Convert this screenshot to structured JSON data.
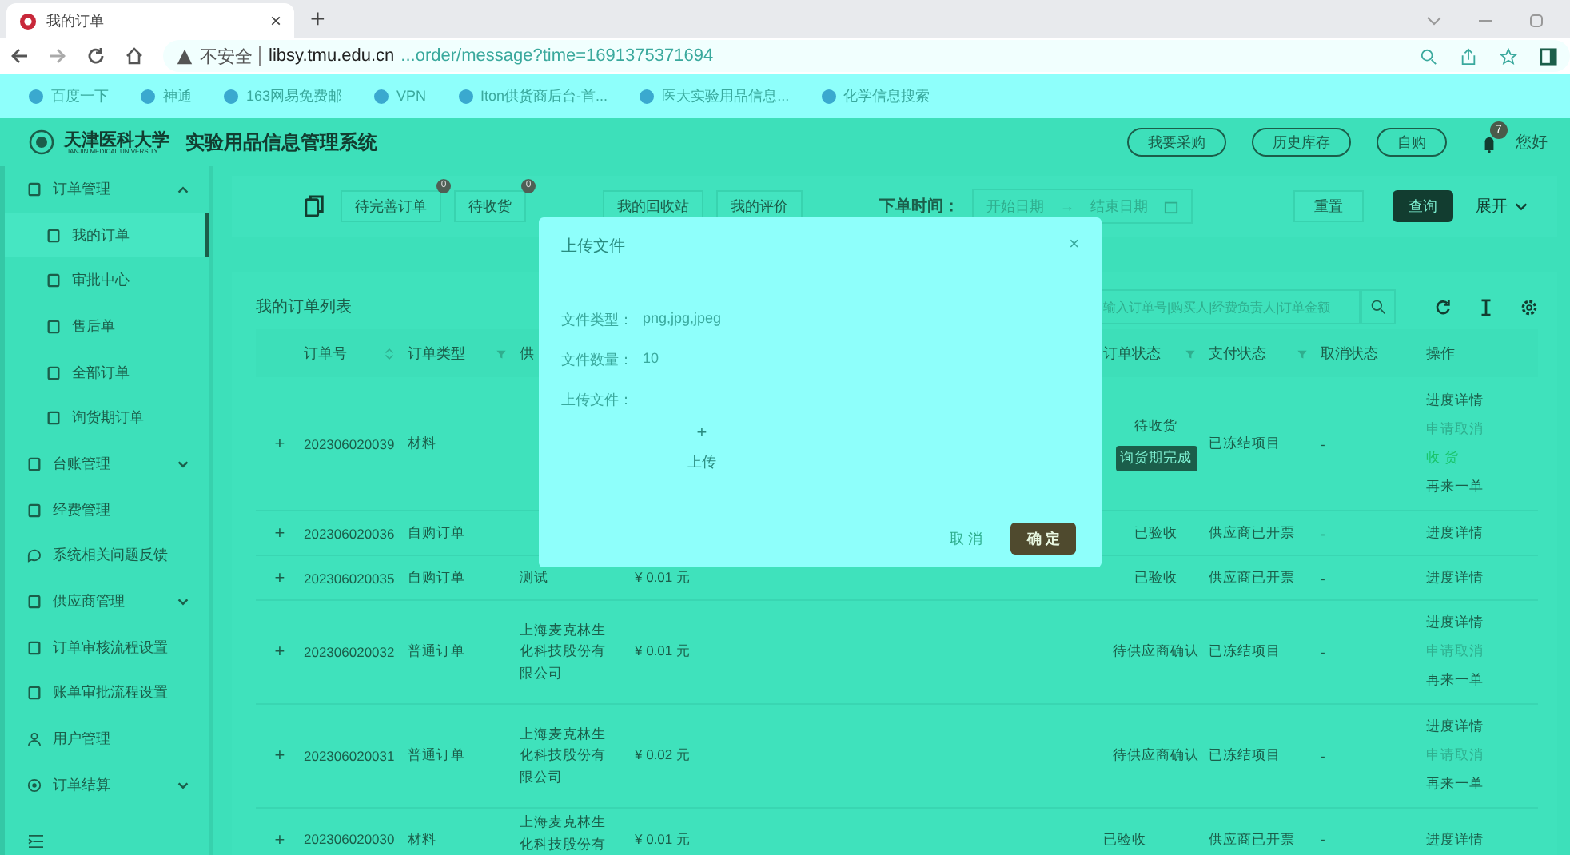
{
  "browser": {
    "tab": {
      "title": "我的订单",
      "close": "×"
    },
    "new_tab": "+",
    "address": {
      "security": "不安全",
      "host": "libsy.tmu.edu.cn",
      "path": "...order/message?time=1691375371694"
    },
    "bookmarks": [
      {
        "label": "百度一下"
      },
      {
        "label": "神通"
      },
      {
        "label": "163网易免费邮"
      },
      {
        "label": "VPN"
      },
      {
        "label": "Iton供货商后台-首..."
      },
      {
        "label": "医大实验用品信息..."
      },
      {
        "label": "化学信息搜索"
      }
    ]
  },
  "header": {
    "logo_text": "天津医科大学",
    "logo_subtitle": "TIANJIN MEDICAL UNIVERSITY",
    "title": "实验用品信息管理系统",
    "buttons": [
      "我要采购",
      "历史库存",
      "自购"
    ],
    "notification_count": "7",
    "greeting": "您好"
  },
  "sidebar": {
    "items": [
      {
        "label": "订单管理",
        "expanded": true,
        "children": [
          {
            "label": "我的订单",
            "selected": true
          },
          {
            "label": "审批中心",
            "selected": false
          },
          {
            "label": "售后单",
            "selected": false
          },
          {
            "label": "全部订单",
            "selected": false
          },
          {
            "label": "询货期订单",
            "selected": false
          }
        ]
      },
      {
        "label": "台账管理",
        "expanded": false
      },
      {
        "label": "经费管理"
      },
      {
        "label": "系统相关问题反馈"
      },
      {
        "label": "供应商管理",
        "expanded": false
      },
      {
        "label": "订单审核流程设置"
      },
      {
        "label": "账单审批流程设置"
      },
      {
        "label": "用户管理"
      },
      {
        "label": "订单结算",
        "expanded": false
      }
    ]
  },
  "filters": {
    "quick": [
      {
        "label": "待完善订单",
        "badge": "0"
      },
      {
        "label": "待收货",
        "badge": "0"
      },
      {
        "label": "我的回收站"
      },
      {
        "label": "我的评价"
      }
    ],
    "date_label": "下单时间：",
    "start_placeholder": "开始日期",
    "arrow": "→",
    "end_placeholder": "结束日期",
    "reset": "重置",
    "search": "查询",
    "expand": "展开"
  },
  "table": {
    "title": "我的订单列表",
    "search_placeholder": "输入订单号|购买人|经费负责人|订单金额",
    "columns": [
      {
        "label": "订单号",
        "sortable": true
      },
      {
        "label": "订单类型",
        "filterable": true
      },
      {
        "label": "供"
      },
      {
        "label": "订单状态",
        "filterable": true
      },
      {
        "label": "支付状态",
        "filterable": true
      },
      {
        "label": "取消状态"
      },
      {
        "label": "操作"
      }
    ],
    "rows": [
      {
        "expand": "+",
        "order_no": "202306020039",
        "type": "材料",
        "status": "待收货",
        "status_tag": "询货期完成",
        "payment": "已冻结项目",
        "cancel": "-",
        "actions": [
          {
            "label": "进度详情",
            "kind": "link"
          },
          {
            "label": "申请取消",
            "kind": "muted"
          },
          {
            "label": "收 货",
            "kind": "success"
          },
          {
            "label": "再来一单",
            "kind": "link"
          }
        ]
      },
      {
        "expand": "+",
        "order_no": "202306020036",
        "type": "自购订单",
        "status": "已验收",
        "payment": "供应商已开票",
        "cancel": "-",
        "actions": [
          {
            "label": "进度详情",
            "kind": "link"
          }
        ]
      },
      {
        "expand": "+",
        "order_no": "202306020035",
        "type": "自购订单",
        "supplier": "测试",
        "amount": "¥ 0.01 元",
        "status": "已验收",
        "payment": "供应商已开票",
        "cancel": "-",
        "actions": [
          {
            "label": "进度详情",
            "kind": "link"
          }
        ]
      },
      {
        "expand": "+",
        "order_no": "202306020032",
        "type": "普通订单",
        "supplier": "上海麦克林生化科技股份有限公司",
        "amount": "¥ 0.01 元",
        "status": "待供应商确认",
        "payment": "已冻结项目",
        "cancel": "-",
        "actions": [
          {
            "label": "进度详情",
            "kind": "link"
          },
          {
            "label": "申请取消",
            "kind": "muted"
          },
          {
            "label": "再来一单",
            "kind": "link"
          }
        ]
      },
      {
        "expand": "+",
        "order_no": "202306020031",
        "type": "普通订单",
        "supplier": "上海麦克林生化科技股份有限公司",
        "amount": "¥ 0.02 元",
        "status": "待供应商确认",
        "payment": "已冻结项目",
        "cancel": "-",
        "actions": [
          {
            "label": "进度详情",
            "kind": "link"
          },
          {
            "label": "申请取消",
            "kind": "muted"
          },
          {
            "label": "再来一单",
            "kind": "link"
          }
        ]
      },
      {
        "expand": "+",
        "order_no": "202306020030",
        "type": "材料",
        "supplier": "上海麦克林生化科技股份有",
        "amount": "¥ 0.01 元",
        "status": "已验收",
        "payment": "供应商已开票",
        "cancel": "-",
        "actions": [
          {
            "label": "进度详情",
            "kind": "link"
          }
        ]
      }
    ]
  },
  "modal": {
    "title": "上传文件",
    "close": "×",
    "fields": [
      {
        "label": "文件类型：",
        "value": "png,jpg,jpeg"
      },
      {
        "label": "文件数量：",
        "value": "10"
      }
    ],
    "upload_label": "上传文件：",
    "upload_plus": "+",
    "upload_text": "上传",
    "cancel": "取 消",
    "ok": "确 定"
  }
}
